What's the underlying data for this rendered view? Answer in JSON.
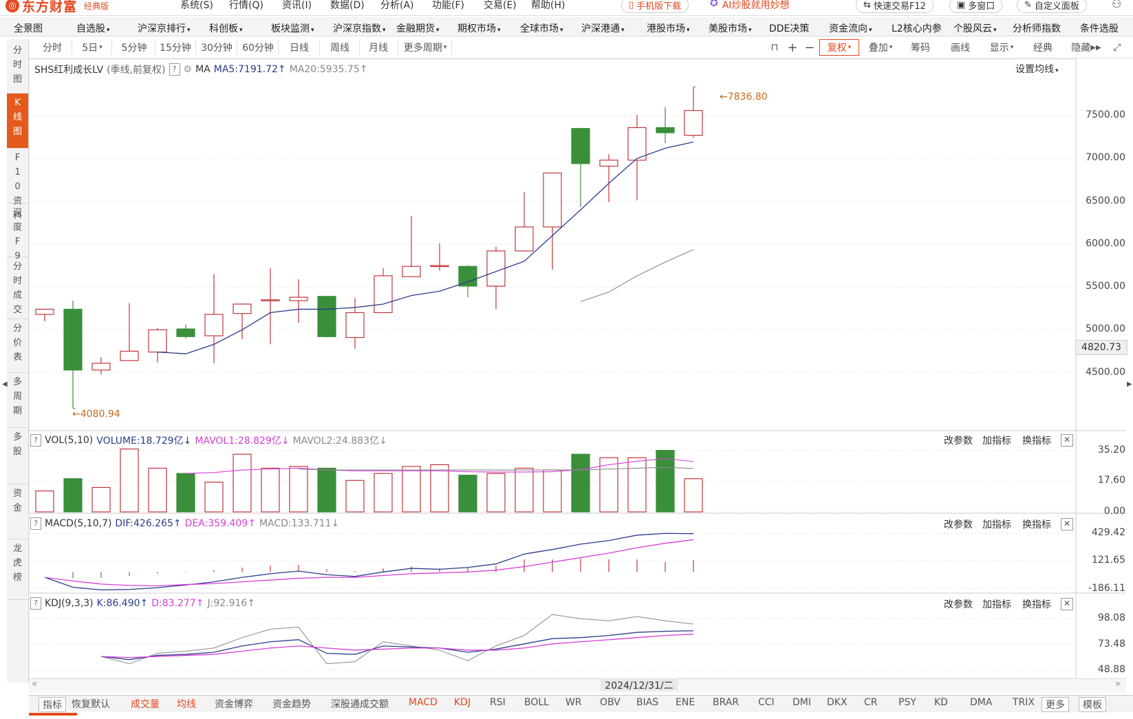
{
  "app": {
    "logo": "东方财富",
    "edition": "经典版",
    "menus": [
      "系统(S)",
      "行情(Q)",
      "资讯(I)",
      "数据(D)",
      "分析(A)",
      "功能(F)",
      "交易(E)",
      "帮助(H)"
    ],
    "mobile_download": "手机版下载",
    "ai_promo": "AI炒股就用妙想",
    "quick_trade": "快速交易F12",
    "multi_window": "多窗口",
    "custom_panel": "自定义面板"
  },
  "nav": [
    "全景图",
    "自选股",
    "沪深京排行",
    "科创板",
    "板块监测",
    "沪深京指数",
    "金融期货",
    "期权市场",
    "全球市场",
    "沪深港通",
    "港股市场",
    "美股市场",
    "DDE决策",
    "资金流向",
    "L2核心内参",
    "个股风云",
    "分析师指数",
    "条件选股"
  ],
  "side_tabs": [
    "分时图",
    "K线图",
    "F10资料",
    "深度F9",
    "分时成交",
    "分价表",
    "多周期",
    "多股",
    "资金",
    "龙虎榜"
  ],
  "periods": [
    "分时",
    "5日",
    "5分钟",
    "15分钟",
    "30分钟",
    "60分钟",
    "日线",
    "周线",
    "月线",
    "更多周期"
  ],
  "right_tools": {
    "fq": "复权",
    "add": "叠加",
    "chips": "筹码",
    "draw": "画线",
    "display": "显示",
    "classic": "经典",
    "hide": "隐藏"
  },
  "kline": {
    "title": "SHS红利成长LV",
    "subtitle": "(季线,前复权)",
    "ma_label": "MA",
    "ma5": "MA5:7191.72",
    "ma20": "MA20:5935.75",
    "set_ma": "设置均线",
    "high_label": "7836.80",
    "low_label": "4080.94",
    "cursor_price": "4820.73",
    "y_ticks": [
      "7500.00",
      "7000.00",
      "6500.00",
      "6000.00",
      "5500.00",
      "5000.00",
      "4500.00"
    ]
  },
  "vol": {
    "title": "VOL(5,10)",
    "volume": "VOLUME:18.729亿",
    "mavol1": "MAVOL1:28.829亿",
    "mavol2": "MAVOL2:24.883亿",
    "y_ticks": [
      "35.20",
      "17.60",
      "0.00"
    ]
  },
  "macd": {
    "title": "MACD(5,10,7)",
    "dif": "DIF:426.265",
    "dea": "DEA:359.409",
    "macd": "MACD:133.711",
    "y_ticks": [
      "429.42",
      "121.65",
      "-186.11"
    ]
  },
  "kdj": {
    "title": "KDJ(9,3,3)",
    "k": "K:86.490",
    "d": "D:83.277",
    "j": "J:92.916",
    "y_ticks": [
      "98.08",
      "73.48",
      "48.88"
    ]
  },
  "panel_actions": [
    "改参数",
    "加指标",
    "换指标"
  ],
  "date_label": "2024/12/31/二",
  "bottom_tabs": [
    "指标",
    "恢复默认",
    "成交量",
    "均线",
    "资金博弈",
    "资金趋势",
    "深股通成交额",
    "MACD",
    "KDJ",
    "RSI",
    "BOLL",
    "WR",
    "OBV",
    "BIAS",
    "ENE",
    "BRAR",
    "CCI",
    "DMI",
    "DKX",
    "CR",
    "PSY",
    "KD",
    "DMA",
    "TRIX",
    "更多",
    "模板"
  ],
  "colors": {
    "up": "#c0353a",
    "down": "#3a8f3a",
    "accent": "#e5481f",
    "ma5": "#2a3c8a",
    "ma20": "#888888",
    "dea": "#d83cd8",
    "label": "#c26a1c"
  },
  "chart_data": {
    "type": "candlestick",
    "candles": [
      {
        "o": 5180,
        "c": 5240,
        "h": 5240,
        "l": 5100
      },
      {
        "o": 5240,
        "c": 4530,
        "h": 5340,
        "l": 4080.94
      },
      {
        "o": 4530,
        "c": 4610,
        "h": 4680,
        "l": 4480
      },
      {
        "o": 4640,
        "c": 4750,
        "h": 5310,
        "l": 4640
      },
      {
        "o": 4740,
        "c": 5000,
        "h": 5020,
        "l": 4620
      },
      {
        "o": 5010,
        "c": 4920,
        "h": 5060,
        "l": 4900
      },
      {
        "o": 4930,
        "c": 5180,
        "h": 5650,
        "l": 4610
      },
      {
        "o": 5190,
        "c": 5300,
        "h": 5310,
        "l": 4890
      },
      {
        "o": 5340,
        "c": 5350,
        "h": 5720,
        "l": 4830
      },
      {
        "o": 5340,
        "c": 5380,
        "h": 5590,
        "l": 5080
      },
      {
        "o": 5390,
        "c": 4920,
        "h": 5390,
        "l": 4910
      },
      {
        "o": 4910,
        "c": 5200,
        "h": 5370,
        "l": 4780
      },
      {
        "o": 5200,
        "c": 5630,
        "h": 5720,
        "l": 5200
      },
      {
        "o": 5620,
        "c": 5740,
        "h": 6330,
        "l": 5620
      },
      {
        "o": 5740,
        "c": 5750,
        "h": 6010,
        "l": 5690
      },
      {
        "o": 5740,
        "c": 5510,
        "h": 5750,
        "l": 5380
      },
      {
        "o": 5510,
        "c": 5920,
        "h": 5970,
        "l": 5240
      },
      {
        "o": 5920,
        "c": 6200,
        "h": 6610,
        "l": 5920
      },
      {
        "o": 6200,
        "c": 6830,
        "h": 6830,
        "l": 5700
      },
      {
        "o": 7350,
        "c": 6940,
        "h": 7350,
        "l": 6430
      },
      {
        "o": 6910,
        "c": 6980,
        "h": 7050,
        "l": 6490
      },
      {
        "o": 6980,
        "c": 7360,
        "h": 7510,
        "l": 6510
      },
      {
        "o": 7360,
        "c": 7300,
        "h": 7600,
        "l": 7180
      },
      {
        "o": 7270,
        "c": 7560,
        "h": 7836.8,
        "l": 7240
      }
    ],
    "ma5": [
      null,
      null,
      null,
      null,
      4740,
      4720,
      4830,
      5000,
      5200,
      5240,
      5240,
      5260,
      5300,
      5400,
      5450,
      5560,
      5680,
      5800,
      6100,
      6400,
      6710,
      7000,
      7120,
      7191.72
    ],
    "ma20": [
      null,
      null,
      null,
      null,
      null,
      null,
      null,
      null,
      null,
      null,
      null,
      null,
      null,
      null,
      null,
      null,
      null,
      null,
      null,
      5330,
      5440,
      5630,
      5790,
      5935.75
    ],
    "volume": [
      12,
      19,
      14,
      36,
      25,
      22,
      17,
      33,
      25,
      26,
      25,
      18,
      22,
      26,
      27,
      21,
      22,
      25,
      24,
      33,
      31,
      31,
      35.2,
      19
    ],
    "mavol1": [
      null,
      null,
      null,
      null,
      null,
      22,
      22.5,
      24,
      24.5,
      25,
      24,
      23.5,
      23.5,
      23.5,
      23.5,
      23,
      22.8,
      22.8,
      23,
      24.2,
      27,
      29,
      30.5,
      28.829
    ],
    "mavol2": [
      null,
      null,
      null,
      null,
      null,
      null,
      null,
      null,
      null,
      24.5,
      24,
      24,
      24,
      24,
      24,
      24,
      24,
      24,
      24,
      24,
      24.5,
      25,
      25.5,
      24.883
    ],
    "macd_dif": [
      -60,
      -170,
      -200,
      -195,
      -175,
      -145,
      -110,
      -60,
      -20,
      10,
      -30,
      -50,
      0,
      40,
      30,
      50,
      90,
      200,
      250,
      310,
      350,
      410,
      430,
      426.265
    ],
    "macd_dea": [
      -60,
      -100,
      -135,
      -150,
      -155,
      -140,
      -130,
      -110,
      -90,
      -70,
      -60,
      -60,
      -40,
      -20,
      -10,
      0,
      20,
      60,
      110,
      160,
      210,
      270,
      320,
      359.409
    ],
    "macd_hist": [
      0,
      -70,
      -65,
      -45,
      -20,
      -5,
      20,
      50,
      70,
      80,
      30,
      10,
      40,
      60,
      40,
      50,
      70,
      140,
      140,
      150,
      140,
      140,
      110,
      133.711
    ],
    "kdj_k": [
      null,
      null,
      62,
      59,
      63,
      64,
      66,
      72,
      76,
      78,
      65,
      64,
      72,
      71,
      70,
      66,
      69,
      74,
      79,
      80,
      82,
      85,
      86,
      86.49
    ],
    "kdj_d": [
      null,
      null,
      62,
      61,
      62,
      63,
      64,
      67,
      70,
      72,
      70,
      68,
      69,
      70,
      70,
      68,
      68,
      70,
      74,
      76,
      78,
      80,
      82,
      83.277
    ],
    "kdj_j": [
      null,
      null,
      62,
      55,
      65,
      67,
      70,
      80,
      88,
      90,
      55,
      57,
      76,
      72,
      68,
      58,
      72,
      82,
      102,
      98,
      96,
      100,
      96,
      92.916
    ]
  }
}
